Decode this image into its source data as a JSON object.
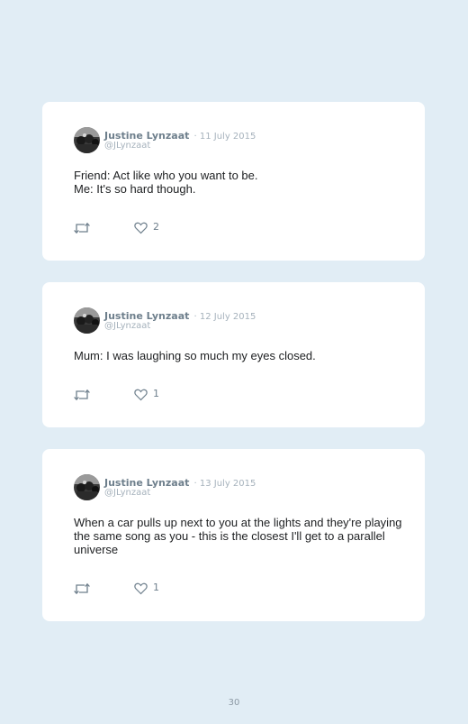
{
  "tweets": [
    {
      "author": "Justine Lynzaat",
      "date": "· 11 July 2015",
      "handle": "@JLynzaat",
      "text": "Friend: Act like who you want to be.\nMe: It's so hard though.",
      "likes": "2",
      "icons": {
        "retweet": "retweet-icon",
        "like": "heart-icon"
      }
    },
    {
      "author": "Justine Lynzaat",
      "date": "· 12 July 2015",
      "handle": "@JLynzaat",
      "text": "Mum: I was laughing so much my eyes closed.",
      "likes": "1",
      "icons": {
        "retweet": "retweet-icon",
        "like": "heart-icon"
      }
    },
    {
      "author": "Justine Lynzaat",
      "date": "· 13 July 2015",
      "handle": "@JLynzaat",
      "text": "When a car pulls up next to you at the lights and they're playing the same song as you - this is the closest I'll get to a parallel universe",
      "likes": "1",
      "icons": {
        "retweet": "retweet-icon",
        "like": "heart-icon"
      }
    }
  ],
  "page": {
    "number": "30"
  },
  "colors": {
    "background": "#e1edf5",
    "card": "#ffffff",
    "name": "#6e7f8c",
    "meta": "#a6b2bc",
    "text": "#1d1f21"
  }
}
